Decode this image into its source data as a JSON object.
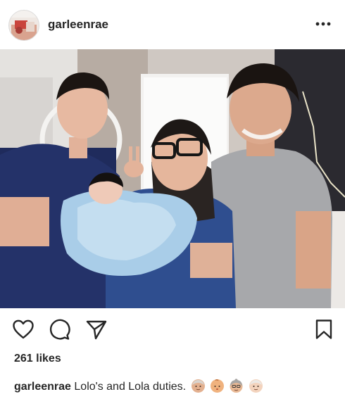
{
  "post": {
    "username": "garleenrae",
    "likes_text": "261 likes",
    "caption": {
      "username": "garleenrae",
      "text": "Lolo's and Lola duties."
    },
    "caption_emojis": [
      "older-man-emoji",
      "baby-emoji",
      "older-woman-emoji",
      "older-man-emoji"
    ]
  },
  "icons": {
    "more": "more-options-icon",
    "like": "heart-icon",
    "comment": "comment-icon",
    "share": "send-icon",
    "save": "bookmark-icon"
  },
  "colors": {
    "text": "#262626",
    "background": "#ffffff",
    "divider": "#dbdbdb"
  }
}
